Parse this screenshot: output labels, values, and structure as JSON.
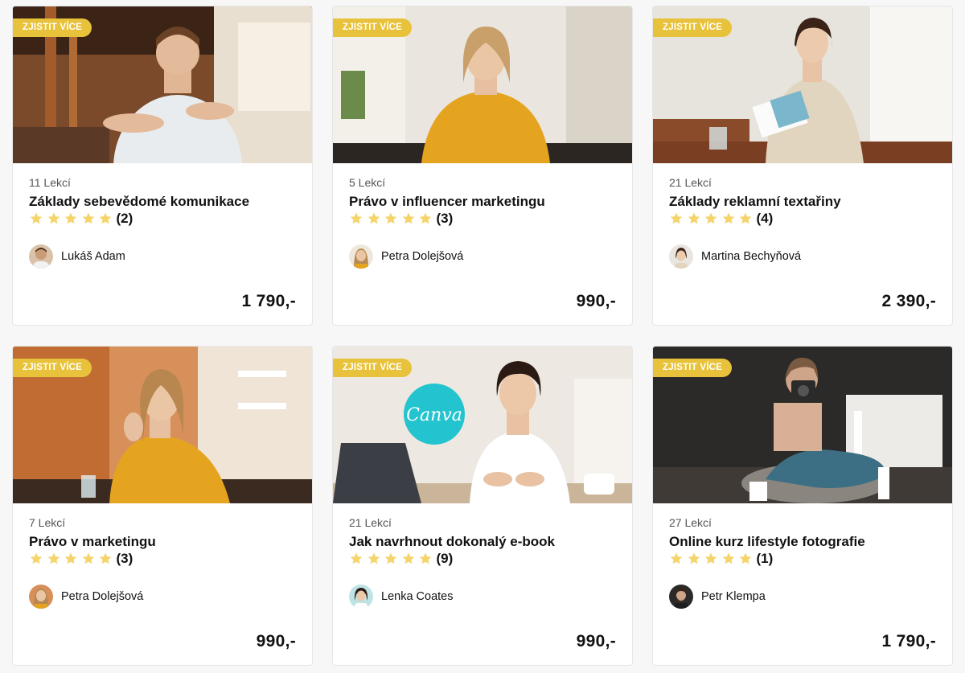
{
  "courses": [
    {
      "badge": "ZJISTIT VÍCE",
      "lessons": "11 Lekcí",
      "title": "Základy sebevědomé komunikace",
      "rating_stars": 5,
      "rating_count": "(2)",
      "author": "Lukáš Adam",
      "price": "1 790,-"
    },
    {
      "badge": "ZJISTIT VÍCE",
      "lessons": "5 Lekcí",
      "title": "Právo v influencer marketingu",
      "rating_stars": 5,
      "rating_count": "(3)",
      "author": "Petra Dolejšová",
      "price": "990,-"
    },
    {
      "badge": "ZJISTIT VÍCE",
      "lessons": "21 Lekcí",
      "title": "Základy reklamní textařiny",
      "rating_stars": 5,
      "rating_count": "(4)",
      "author": "Martina Bechyňová",
      "price": "2 390,-"
    },
    {
      "badge": "ZJISTIT VÍCE",
      "lessons": "7 Lekcí",
      "title": "Právo v marketingu",
      "rating_stars": 5,
      "rating_count": "(3)",
      "author": "Petra Dolejšová",
      "price": "990,-"
    },
    {
      "badge": "ZJISTIT VÍCE",
      "lessons": "21 Lekcí",
      "title": "Jak navrhnout dokonalý e-book",
      "rating_stars": 5,
      "rating_count": "(9)",
      "author": "Lenka Coates",
      "price": "990,-",
      "image_logo_text": "Canva"
    },
    {
      "badge": "ZJISTIT VÍCE",
      "lessons": "27 Lekcí",
      "title": "Online kurz lifestyle fotografie",
      "rating_stars": 5,
      "rating_count": "(1)",
      "author": "Petr Klempa",
      "price": "1 790,-"
    }
  ],
  "colors": {
    "badge_bg": "#e8c23a",
    "star": "#f4d46b",
    "canva_logo": "#23c4cf"
  },
  "icons": {
    "rating": "star-icon"
  }
}
